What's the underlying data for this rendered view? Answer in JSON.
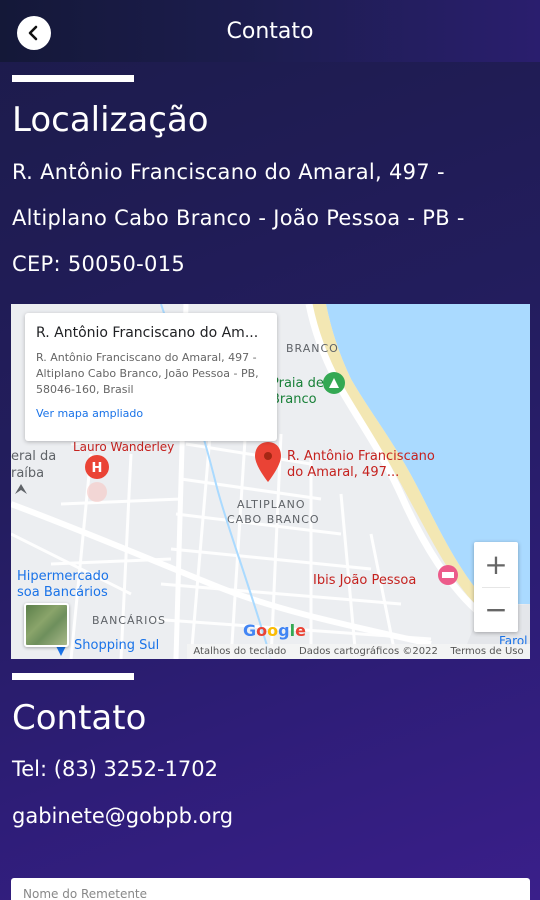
{
  "header": {
    "title": "Contato"
  },
  "location": {
    "heading": "Localização",
    "address_lines": [
      "R. Antônio Franciscano do Amaral, 497 -",
      "Altiplano Cabo Branco - João Pessoa - PB -",
      "CEP: 50050-015"
    ]
  },
  "map": {
    "info_title": "R. Antônio Franciscano do Am...",
    "info_body": "R. Antônio Franciscano do Amaral, 497 - Altiplano Cabo Branco, João Pessoa - PB, 58046-160, Brasil",
    "info_link": "Ver mapa ampliado",
    "pin_label_1": "R. Antônio Franciscano",
    "pin_label_2": "do Amaral, 497...",
    "labels": {
      "cabo_branco": "BRANCO",
      "praia_1": "Praia de",
      "praia_2": "Branco",
      "lauro": "Lauro Wanderley",
      "altiplano_1": "ALTIPLANO",
      "altiplano_2": "CABO BRANCO",
      "ibis": "Ibis João Pessoa",
      "hiper_1": "Hipermercado",
      "hiper_2": "soa Bancários",
      "bancarios": "BANCÁRIOS",
      "shopping": "Shopping Sul",
      "left_1": "eral da",
      "left_2": "raíba",
      "faro": "Farol"
    },
    "zoom_in": "+",
    "zoom_out": "−",
    "google": "Google",
    "footer": [
      "Atalhos do teclado",
      "Dados cartográficos ©2022",
      "Termos de Uso"
    ],
    "colors": {
      "water": "#aadaff",
      "land": "#e8eaed",
      "pin": "#ea4335",
      "park": "#34a853"
    }
  },
  "contact": {
    "heading": "Contato",
    "phone": "Tel: (83) 3252-1702",
    "email": "gabinete@gobpb.org"
  },
  "form": {
    "sender_placeholder": "Nome do Remetente"
  }
}
